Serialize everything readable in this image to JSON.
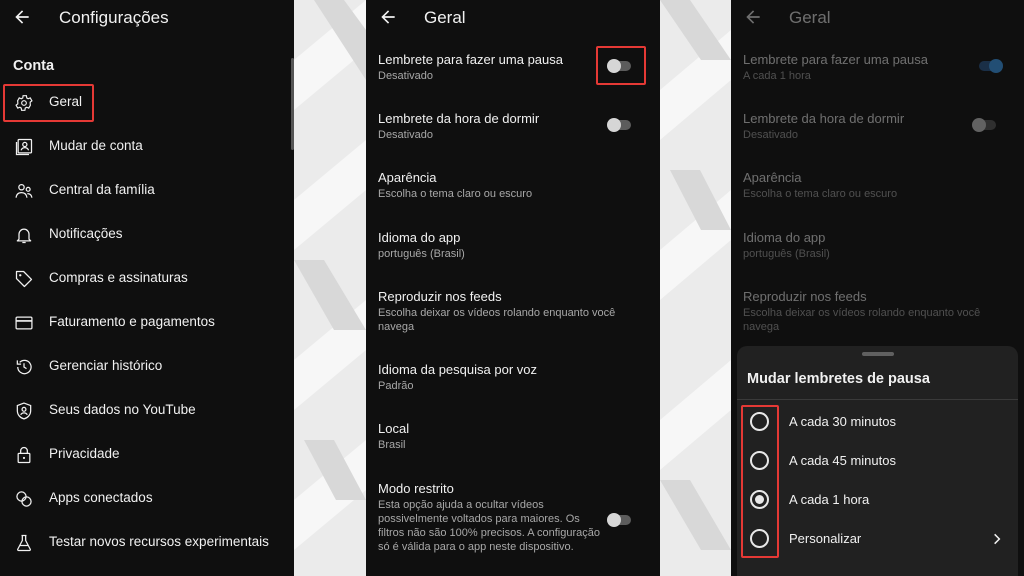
{
  "colors": {
    "panel_bg": "#0f0f0f",
    "highlight": "#e53935",
    "toggle_on": "#3ea6ff",
    "sheet_bg": "#212121"
  },
  "settings_panel": {
    "title": "Configurações",
    "section": "Conta",
    "items": [
      {
        "label": "Geral",
        "icon": "gear-icon"
      },
      {
        "label": "Mudar de conta",
        "icon": "switch-account-icon"
      },
      {
        "label": "Central da família",
        "icon": "family-icon"
      },
      {
        "label": "Notificações",
        "icon": "bell-icon"
      },
      {
        "label": "Compras e assinaturas",
        "icon": "tag-icon"
      },
      {
        "label": "Faturamento e pagamentos",
        "icon": "credit-card-icon"
      },
      {
        "label": "Gerenciar histórico",
        "icon": "history-icon"
      },
      {
        "label": "Seus dados no YouTube",
        "icon": "shield-person-icon"
      },
      {
        "label": "Privacidade",
        "icon": "lock-icon"
      },
      {
        "label": "Apps conectados",
        "icon": "link-icon"
      },
      {
        "label": "Testar novos recursos experimentais",
        "icon": "flask-icon"
      }
    ]
  },
  "general_panel": {
    "title": "Geral",
    "settings": [
      {
        "title": "Lembrete para fazer uma pausa",
        "subtitle": "Desativado",
        "toggle": false
      },
      {
        "title": "Lembrete da hora de dormir",
        "subtitle": "Desativado",
        "toggle": false
      },
      {
        "title": "Aparência",
        "subtitle": "Escolha o tema claro ou escuro"
      },
      {
        "title": "Idioma do app",
        "subtitle": "português (Brasil)"
      },
      {
        "title": "Reproduzir nos feeds",
        "subtitle": "Escolha deixar os vídeos rolando enquanto você navega"
      },
      {
        "title": "Idioma da pesquisa por voz",
        "subtitle": "Padrão"
      },
      {
        "title": "Local",
        "subtitle": "Brasil"
      },
      {
        "title": "Modo restrito",
        "subtitle": "Esta opção ajuda a ocultar vídeos possivelmente voltados para maiores. Os filtros não são 100% precisos. A configuração só é válida para o app neste dispositivo.",
        "toggle": false
      }
    ]
  },
  "dialog_panel": {
    "title": "Geral",
    "settings": [
      {
        "title": "Lembrete para fazer uma pausa",
        "subtitle": "A cada 1 hora",
        "toggle": true
      },
      {
        "title": "Lembrete da hora de dormir",
        "subtitle": "Desativado",
        "toggle": false
      },
      {
        "title": "Aparência",
        "subtitle": "Escolha o tema claro ou escuro"
      },
      {
        "title": "Idioma do app",
        "subtitle": "português (Brasil)"
      },
      {
        "title": "Reproduzir nos feeds",
        "subtitle": "Escolha deixar os vídeos rolando enquanto você navega"
      }
    ],
    "sheet": {
      "title": "Mudar lembretes de pausa",
      "options": [
        {
          "label": "A cada 30 minutos",
          "selected": false
        },
        {
          "label": "A cada 45 minutos",
          "selected": false
        },
        {
          "label": "A cada 1 hora",
          "selected": true
        },
        {
          "label": "Personalizar",
          "selected": false,
          "chevron": true
        }
      ]
    }
  }
}
